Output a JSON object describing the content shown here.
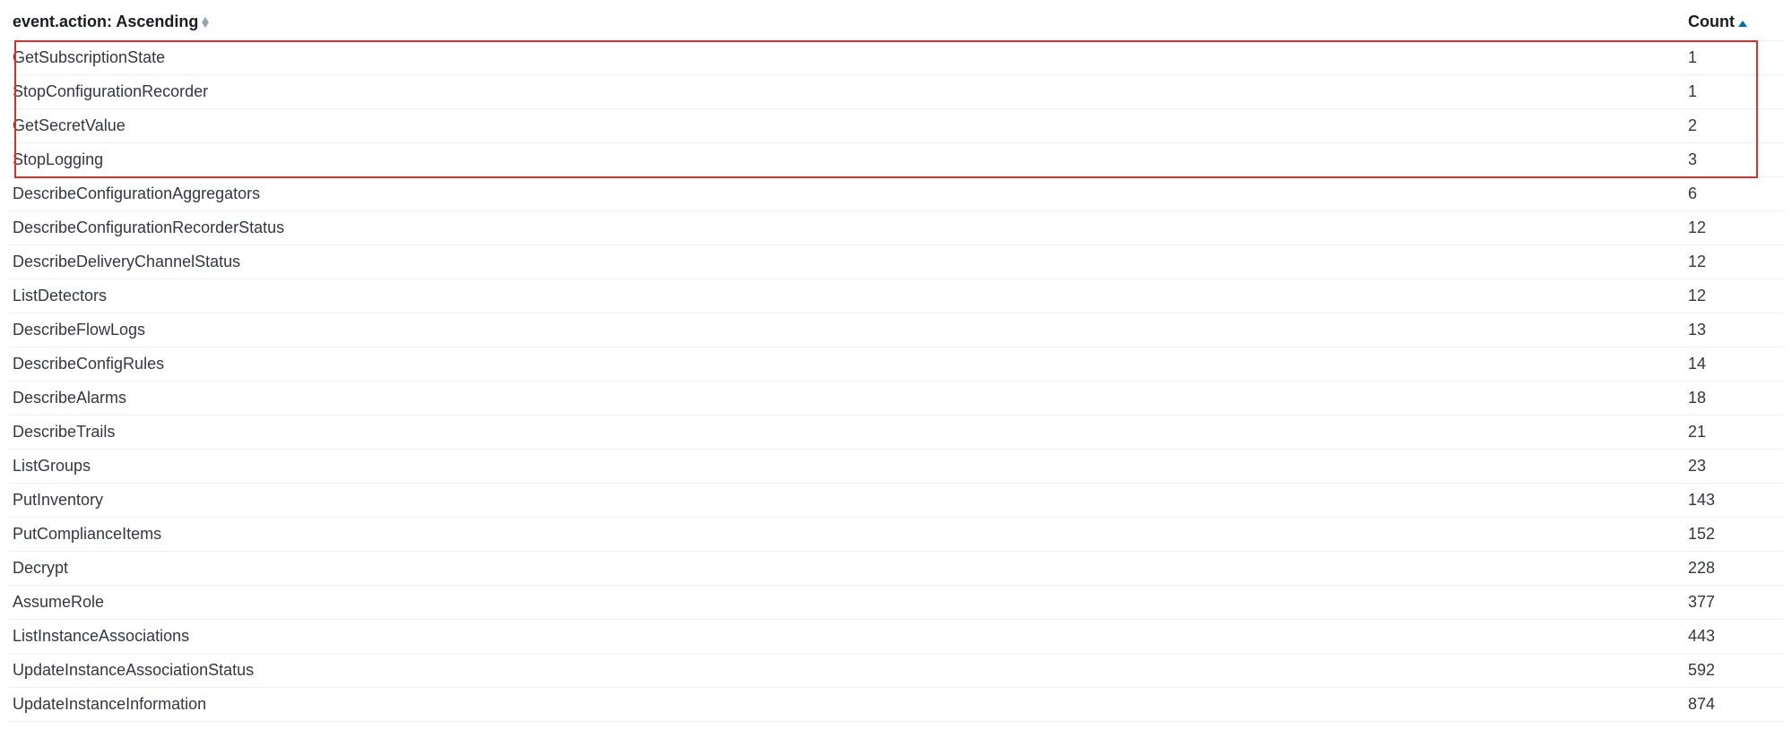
{
  "table": {
    "headers": {
      "action_label": "event.action: Ascending",
      "count_label": "Count"
    },
    "rows": [
      {
        "action": "GetSubscriptionState",
        "count": "1"
      },
      {
        "action": "StopConfigurationRecorder",
        "count": "1"
      },
      {
        "action": "GetSecretValue",
        "count": "2"
      },
      {
        "action": "StopLogging",
        "count": "3"
      },
      {
        "action": "DescribeConfigurationAggregators",
        "count": "6"
      },
      {
        "action": "DescribeConfigurationRecorderStatus",
        "count": "12"
      },
      {
        "action": "DescribeDeliveryChannelStatus",
        "count": "12"
      },
      {
        "action": "ListDetectors",
        "count": "12"
      },
      {
        "action": "DescribeFlowLogs",
        "count": "13"
      },
      {
        "action": "DescribeConfigRules",
        "count": "14"
      },
      {
        "action": "DescribeAlarms",
        "count": "18"
      },
      {
        "action": "DescribeTrails",
        "count": "21"
      },
      {
        "action": "ListGroups",
        "count": "23"
      },
      {
        "action": "PutInventory",
        "count": "143"
      },
      {
        "action": "PutComplianceItems",
        "count": "152"
      },
      {
        "action": "Decrypt",
        "count": "228"
      },
      {
        "action": "AssumeRole",
        "count": "377"
      },
      {
        "action": "ListInstanceAssociations",
        "count": "443"
      },
      {
        "action": "UpdateInstanceAssociationStatus",
        "count": "592"
      },
      {
        "action": "UpdateInstanceInformation",
        "count": "874"
      }
    ],
    "highlight_row_start": 0,
    "highlight_row_end": 3
  }
}
